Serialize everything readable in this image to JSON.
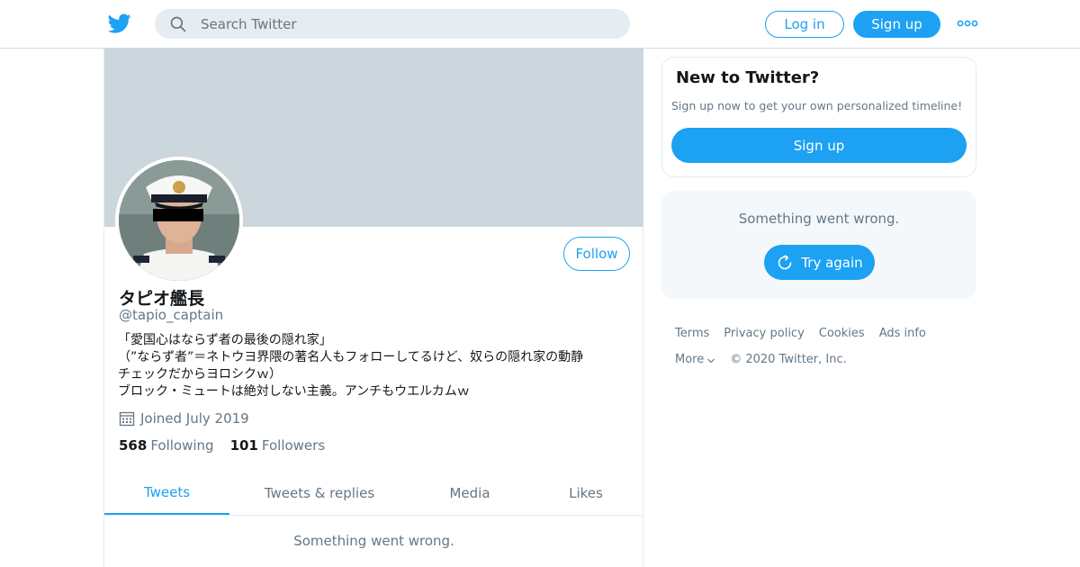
{
  "colors": {
    "accent": "#1da1f2",
    "banner": "#ccd6dd",
    "muted_text": "#657786",
    "card_bg": "#f5f8fa"
  },
  "header": {
    "logo_icon": "twitter-bird-icon",
    "search_placeholder": "Search Twitter",
    "login_label": "Log in",
    "signup_label": "Sign up",
    "more_icon": "more-dots-icon"
  },
  "profile": {
    "follow_label": "Follow",
    "display_name": "タピオ艦長",
    "handle": "@tapio_captain",
    "bio_lines": [
      "「愛国心はならず者の最後の隠れ家」",
      "（”ならず者”＝ネトウヨ界隈の著名人もフォローしてるけど、奴らの隠れ家の動静",
      "チェックだからヨロシクｗ）",
      "ブロック・ミュートは絶対しない主義。アンチもウエルカムｗ"
    ],
    "joined": "Joined July 2019",
    "following_count": "568",
    "following_label": "Following",
    "followers_count": "101",
    "followers_label": "Followers",
    "tabs": [
      "Tweets",
      "Tweets & replies",
      "Media",
      "Likes"
    ],
    "active_tab": "Tweets",
    "error_text": "Something went wrong."
  },
  "sidebar": {
    "new_title": "New to Twitter?",
    "new_subtitle": "Sign up now to get your own personalized timeline!",
    "signup_label": "Sign up",
    "error_text": "Something went wrong.",
    "try_again_label": "Try again"
  },
  "footer": {
    "links": [
      "Terms",
      "Privacy policy",
      "Cookies",
      "Ads info"
    ],
    "more_label": "More",
    "copyright": "© 2020 Twitter, Inc."
  }
}
